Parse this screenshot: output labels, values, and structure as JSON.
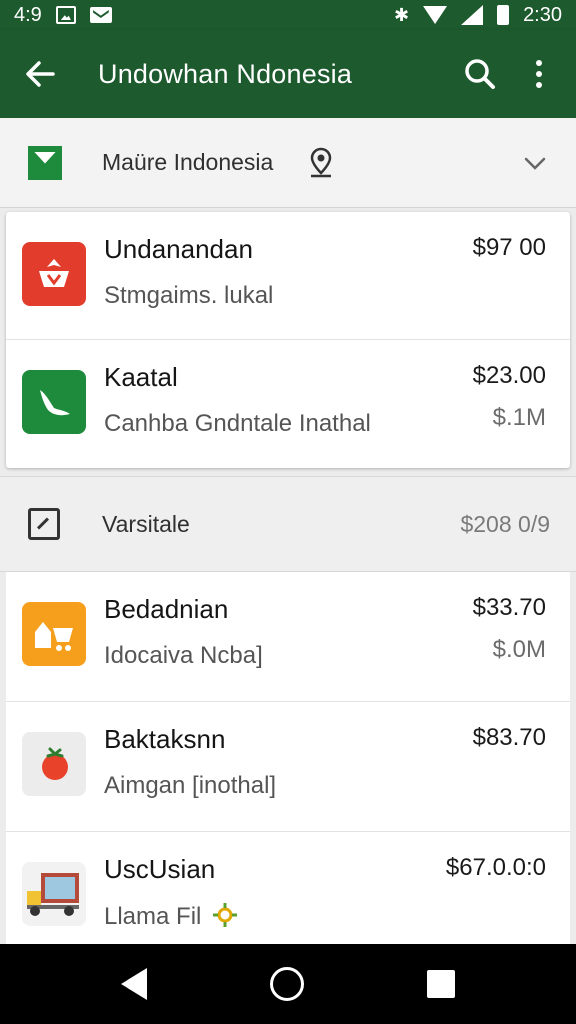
{
  "status_bar": {
    "time_left": "4:9",
    "time_right": "2:30",
    "icons": [
      "image-icon",
      "mail-icon",
      "bluetooth-icon",
      "wifi-icon",
      "signal-icon",
      "battery-icon"
    ]
  },
  "app_bar": {
    "title": "Undowhan Ndonesia",
    "color": "#1d5a2e"
  },
  "region": {
    "label": "Maüre Indonesia"
  },
  "top_items": [
    {
      "title": "Undanandan",
      "subtitle": "Stmgaims. lukal",
      "price": "$97 00",
      "size": "",
      "icon": "red-cart-icon",
      "icon_color": "#e23d2c"
    },
    {
      "title": "Kaatal",
      "subtitle": "Canhba Gndntale Inathal",
      "price": "$23.00",
      "size": "$.1M",
      "icon": "green-bird-icon",
      "icon_color": "#1e8a3c"
    }
  ],
  "section": {
    "label": "Varsitale",
    "value": "$208 0/9"
  },
  "list_items": [
    {
      "title": "Bedadnian",
      "subtitle": "Idocaiva Ncba]",
      "price": "$33.70",
      "size": "$.0M",
      "icon": "orange-cart-icon",
      "icon_color": "#f59f1c"
    },
    {
      "title": "Baktaksnn",
      "subtitle": "Aimgan [inothal]",
      "price": "$83.70",
      "size": "",
      "icon": "tomato-icon",
      "icon_color": "#e8e8e8"
    },
    {
      "title": "UscUsian",
      "subtitle": "Llama Fil",
      "price": "$67.0.0:0",
      "size": "",
      "icon": "truck-icon",
      "icon_color": "#f2f2f2"
    }
  ]
}
